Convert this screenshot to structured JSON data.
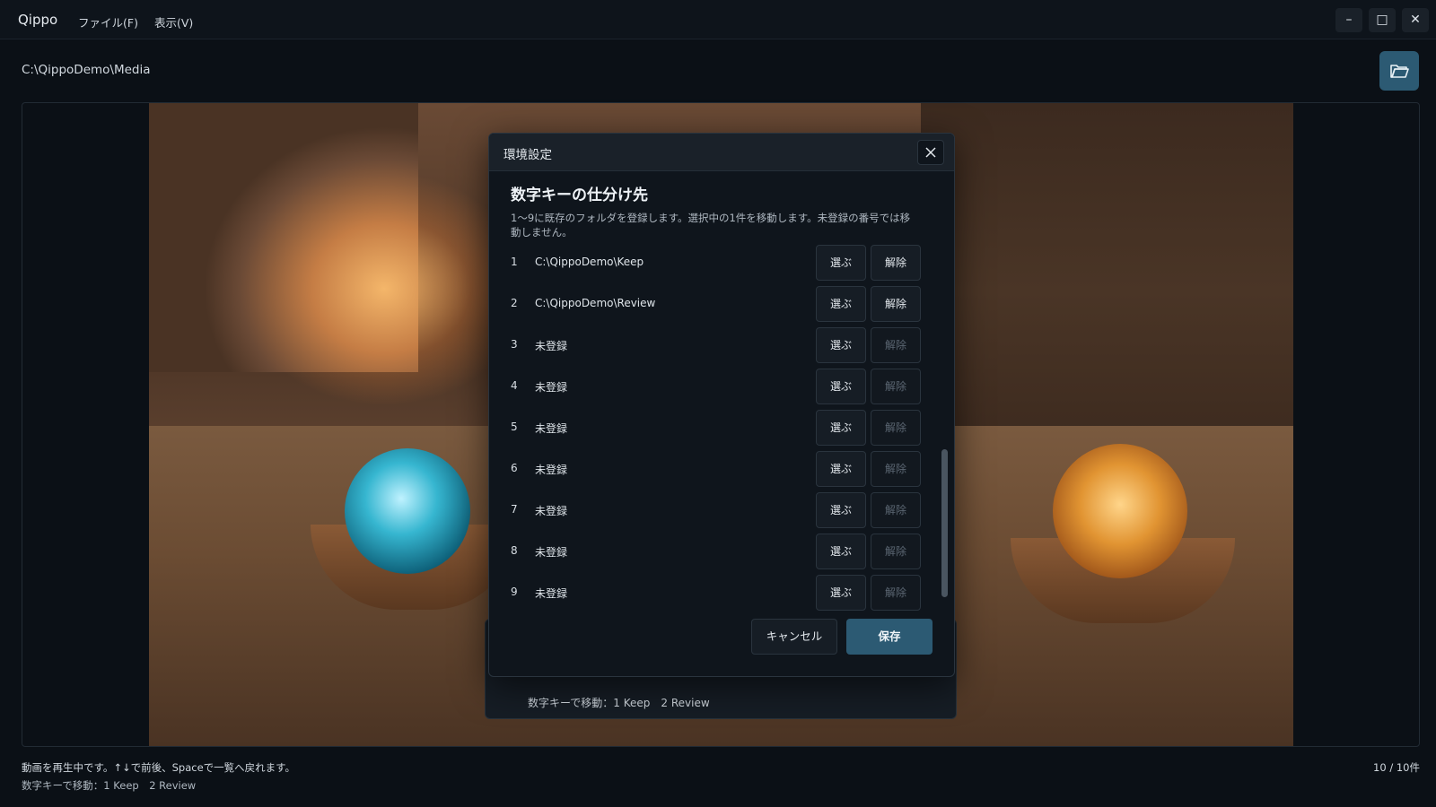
{
  "app": {
    "title": "Qippo",
    "menu": [
      "ファイル(F)",
      "表示(V)"
    ],
    "window_controls": {
      "minimize": "–",
      "maximize": "□",
      "close": "✕"
    }
  },
  "toolbar": {
    "path": "C:\\QippoDemo\\Media",
    "open_folder_icon": "folder-open-icon"
  },
  "player": {
    "key_hint": "数字キーで移動：1 Keep　2 Review"
  },
  "dialog": {
    "title": "環境設定",
    "section_title": "数字キーの仕分け先",
    "description": "1〜9に既存のフォルダを登録します。選択中の1件を移動します。未登録の番号では移動しません。",
    "choose_label": "選ぶ",
    "clear_label": "解除",
    "slots": [
      {
        "num": "1",
        "path": "C:\\QippoDemo\\Keep",
        "registered": true
      },
      {
        "num": "2",
        "path": "C:\\QippoDemo\\Review",
        "registered": true
      },
      {
        "num": "3",
        "path": "未登録",
        "registered": false
      },
      {
        "num": "4",
        "path": "未登録",
        "registered": false
      },
      {
        "num": "5",
        "path": "未登録",
        "registered": false
      },
      {
        "num": "6",
        "path": "未登録",
        "registered": false
      },
      {
        "num": "7",
        "path": "未登録",
        "registered": false
      },
      {
        "num": "8",
        "path": "未登録",
        "registered": false
      },
      {
        "num": "9",
        "path": "未登録",
        "registered": false
      }
    ],
    "cancel_label": "キャンセル",
    "save_label": "保存"
  },
  "footer": {
    "status": "動画を再生中です。↑↓で前後、Spaceで一覧へ戻れます。",
    "key_hint": "数字キーで移動：1 Keep　2 Review",
    "count": "10 / 10件"
  },
  "colors": {
    "accent": "#2c5a73",
    "background": "#0b1016",
    "panel": "#0f151c"
  }
}
